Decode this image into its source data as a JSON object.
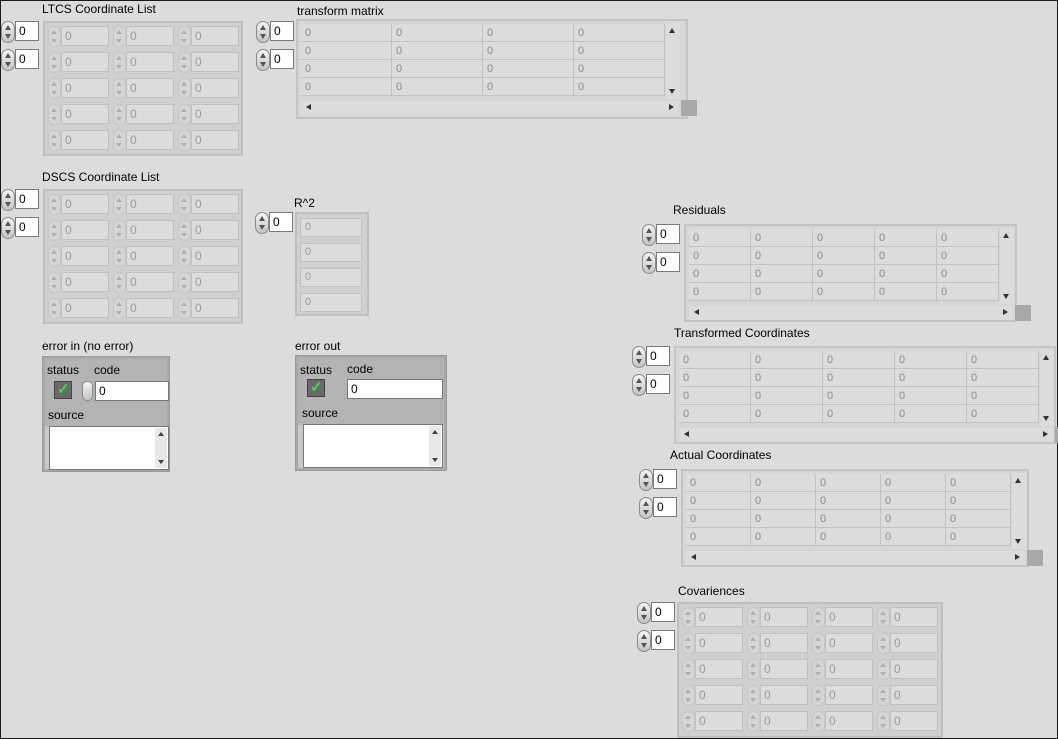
{
  "ltcs": {
    "label": "LTCS Coordinate List",
    "index": [
      "0",
      "0"
    ],
    "cells": [
      "0",
      "0",
      "0",
      "0",
      "0",
      "0",
      "0",
      "0",
      "0",
      "0",
      "0",
      "0",
      "0",
      "0",
      "0"
    ]
  },
  "transform": {
    "label": "transform matrix",
    "index": [
      "0",
      "0"
    ],
    "cells": [
      "0",
      "0",
      "0",
      "0",
      "0",
      "0",
      "0",
      "0",
      "0",
      "0",
      "0",
      "0",
      "0",
      "0",
      "0",
      "0"
    ]
  },
  "dscs": {
    "label": "DSCS Coordinate List",
    "index": [
      "0",
      "0"
    ],
    "cells": [
      "0",
      "0",
      "0",
      "0",
      "0",
      "0",
      "0",
      "0",
      "0",
      "0",
      "0",
      "0",
      "0",
      "0",
      "0"
    ]
  },
  "r2": {
    "label": "R^2",
    "index": [
      "0"
    ],
    "cells": [
      "0",
      "0",
      "0",
      "0"
    ]
  },
  "residuals": {
    "label": "Residuals",
    "index": [
      "0",
      "0"
    ],
    "cells": [
      "0",
      "0",
      "0",
      "0",
      "0",
      "0",
      "0",
      "0",
      "0",
      "0",
      "0",
      "0",
      "0",
      "0",
      "0",
      "0",
      "0",
      "0",
      "0",
      "0"
    ]
  },
  "transformed": {
    "label": "Transformed Coordinates",
    "index": [
      "0",
      "0"
    ],
    "cells": [
      "0",
      "0",
      "0",
      "0",
      "0",
      "0",
      "0",
      "0",
      "0",
      "0",
      "0",
      "0",
      "0",
      "0",
      "0",
      "0",
      "0",
      "0",
      "0",
      "0"
    ]
  },
  "actual": {
    "label": "Actual Coordinates",
    "index": [
      "0",
      "0"
    ],
    "cells": [
      "0",
      "0",
      "0",
      "0",
      "0",
      "0",
      "0",
      "0",
      "0",
      "0",
      "0",
      "0",
      "0",
      "0",
      "0",
      "0",
      "0",
      "0",
      "0",
      "0"
    ]
  },
  "covariences": {
    "label": "Covariences",
    "index": [
      "0",
      "0"
    ],
    "cells": [
      "0",
      "0",
      "0",
      "0",
      "0",
      "0",
      "0",
      "0",
      "0",
      "0",
      "0",
      "0",
      "0",
      "0",
      "0",
      "0",
      "0",
      "0",
      "0",
      "0"
    ]
  },
  "error_in": {
    "label": "error in (no error)",
    "status_label": "status",
    "code_label": "code",
    "code": "0",
    "source_label": "source",
    "source": ""
  },
  "error_out": {
    "label": "error out",
    "status_label": "status",
    "code_label": "code",
    "code": "0",
    "source_label": "source",
    "source": ""
  },
  "colors": {
    "panel": "#dcdcdc",
    "status_ok": "#2fe82f"
  }
}
